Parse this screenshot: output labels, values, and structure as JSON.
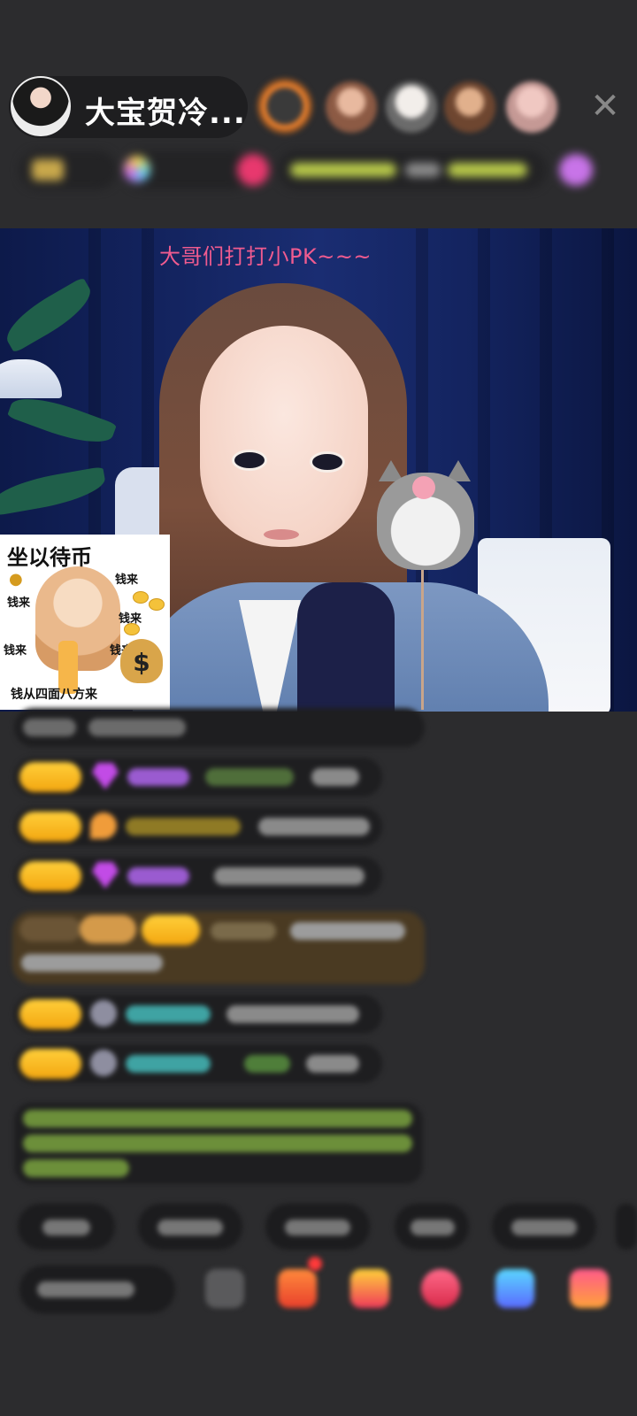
{
  "host": {
    "name": "大宝贺冷...",
    "avatar_icon": "host-avatar"
  },
  "header": {
    "viewer_avatars": [
      {
        "color": "#d46a2a"
      },
      {
        "color": "#c98b6e"
      },
      {
        "color": "#e8e2dc"
      },
      {
        "color": "#b8785a"
      },
      {
        "color": "#e3b4b0"
      }
    ],
    "close_label": "✕"
  },
  "stream": {
    "overlay_text": "大哥们打打小PK~~~"
  },
  "sticker": {
    "title": "坐以待币",
    "words": [
      "钱来",
      "钱来",
      "钱来",
      "钱来",
      "钱来"
    ],
    "bottom": "钱从四面八方来",
    "money_symbol": "$"
  },
  "colors": {
    "background": "#2c2c2e",
    "overlay_pink": "#f05b8f",
    "badge_yellow": "#f3a610"
  }
}
